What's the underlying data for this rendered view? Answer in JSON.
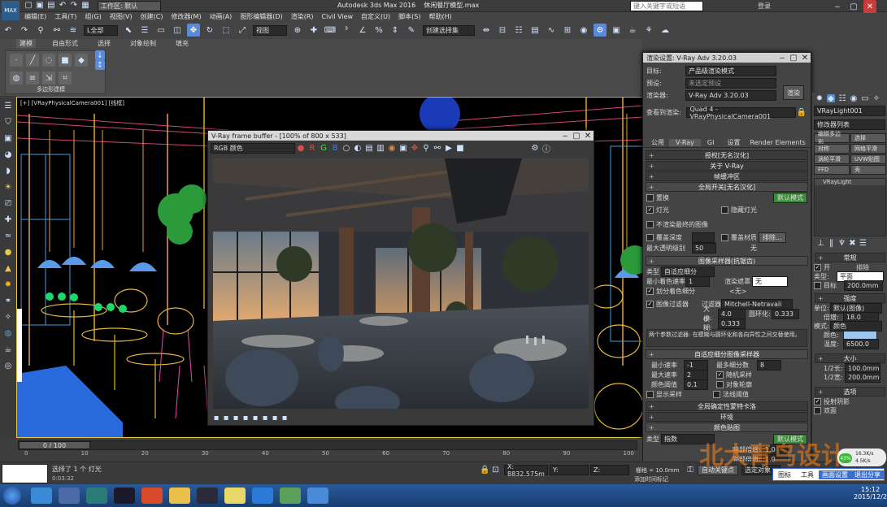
{
  "app": {
    "logo_text": "MAX",
    "workspace_label": "工作区: 默认",
    "title": "Autodesk 3ds Max 2016",
    "file_name": "休闲餐厅模型.max",
    "search_placeholder": "键入关键字或短语",
    "login": "登录"
  },
  "menu": [
    "编辑(E)",
    "工具(T)",
    "组(G)",
    "视图(V)",
    "创建(C)",
    "修改器(M)",
    "动画(A)",
    "图形编辑器(D)",
    "渲染(R)",
    "Civil View",
    "自定义(U)",
    "脚本(S)",
    "帮助(H)"
  ],
  "toolbar": {
    "selection_filter": "L全部",
    "view_dropdown": "视图",
    "named_selection": "创建选择集"
  },
  "ribbon": {
    "tabs": [
      "建模",
      "自由形式",
      "选择",
      "对象绘制",
      "填充"
    ],
    "panel_label": "多边形建模"
  },
  "viewport": {
    "label": "[+] [VRayPhysicalCamera001] [线框]"
  },
  "frame_buffer": {
    "title": "V-Ray frame buffer - [100% of 800 x 533]",
    "channel": "RGB 颜色"
  },
  "render_setup": {
    "title": "渲染设置: V-Ray Adv 3.20.03",
    "target_label": "目标:",
    "target_value": "产品级渲染模式",
    "preset_label": "预设:",
    "preset_value": "未选定预设",
    "renderer_label": "渲染器:",
    "renderer_value": "V-Ray Adv 3.20.03",
    "view_label": "查看到渲染:",
    "view_value": "Quad 4 - VRayPhysicalCamera001",
    "render_button": "渲染",
    "tabs": [
      "公用",
      "V-Ray",
      "GI",
      "设置",
      "Render Elements"
    ],
    "rollouts_top": [
      "授权[无名汉化]",
      "关于 V-Ray",
      "帧缓冲区"
    ],
    "global_switch": "全局开关[无名汉化]",
    "displacement": "置换",
    "default_mode": "默认模式",
    "lights": "灯光",
    "hidden_lights": "隐藏灯光",
    "no_render_final": "不渲染最终的图像",
    "override_depth": "覆盖深度",
    "override_material": "覆盖材质",
    "exclude": "排除...",
    "max_transp": "最大透明级别",
    "max_transp_val": "50",
    "none": "无",
    "image_sampler": "图像采样器(抗锯齿)",
    "type_label": "类型",
    "type_value": "自适应细分",
    "min_rate": "最小着色速率",
    "min_rate_val": "1",
    "render_mask": "渲染遮罩",
    "render_mask_val": "无",
    "divide_shading": "划分着色细分",
    "none_tag": "<无>",
    "filter_label": "图像过滤器",
    "filter_field": "过滤器",
    "filter_value": "Mitchell-Netravali",
    "size_label": "大小:",
    "size_val": "4.0",
    "blur_label": "圆环化:",
    "blur_val": "0.333",
    "ring_label": "模糊:",
    "ring_val": "0.333",
    "filter_desc": "两个参数过滤器: 在模糊与圆环化和各向异性之间交替使用。",
    "adaptive": "自适应细分图像采样器",
    "min_sub": "最小速率",
    "min_sub_val": "-1",
    "max_sub": "最大速率",
    "max_sub_val": "2",
    "color_thresh": "颜色阈值",
    "color_thresh_val": "0.1",
    "max_per": "最多细分数",
    "max_per_val": "8",
    "show_samples": "显示采样",
    "random_sample": "随机采样",
    "object_outline": "对象轮廓",
    "normals": "法线阈值",
    "global_dmc": "全局确定性蒙特卡洛",
    "environment": "环境",
    "color_mapping": "颜色贴图",
    "cm_type_label": "类型",
    "cm_type_value": "指数",
    "dark_mult": "暗部倍增:",
    "dark_mult_val": "1.0",
    "bright_mult": "亮部倍增:",
    "bright_mult_val": "1.0",
    "default_mode2": "默认模式"
  },
  "command_panel": {
    "object_name": "VRayLight001",
    "modifier_list": "修改器列表",
    "btns": [
      "编辑多边形",
      "选择",
      "对称",
      "网格平滑",
      "涡轮平滑",
      "UVW贴图",
      "FFD",
      "壳"
    ],
    "stack_item": "VRayLight",
    "general": "常规",
    "on": "开",
    "exclude": "排除",
    "type_label": "类型:",
    "type_value": "平面",
    "target": "目标",
    "target_val": "200.0mm",
    "intensity": "强度",
    "units_label": "单位:",
    "units_value": "默认(图像)",
    "multiplier": "倍增:",
    "multiplier_val": "18.0",
    "mode_label": "模式:",
    "mode_value": "颜色",
    "color_label": "颜色:",
    "temp_label": "温度:",
    "temp_val": "6500.0",
    "size": "大小",
    "half_len": "1/2长:",
    "half_len_val": "100.0mm",
    "half_wid": "1/2宽:",
    "half_wid_val": "200.0mm",
    "options": "选项",
    "cast_shadows": "投射阴影",
    "double_sided": "双面"
  },
  "timeline": {
    "frame": "0 / 100",
    "ticks": [
      "0",
      "10",
      "20",
      "30",
      "40",
      "50",
      "60",
      "70",
      "80",
      "90",
      "100"
    ]
  },
  "status": {
    "selected": "选择了 1 个 灯光",
    "time_display": "0:03:32",
    "x": "X: 8832.575m",
    "y": "Y:",
    "z": "Z:",
    "grid": "栅格 = 10.0mm",
    "add_time_tag": "添加时间标记",
    "auto_key": "自动关键点",
    "select_obj": "选定对象"
  },
  "watermark": "北大青鸟设计",
  "ime_bar": [
    "图标",
    "工具",
    "画面设置",
    "退出分享"
  ],
  "network": {
    "up": "16.3K/s",
    "down": "4.5K/s",
    "percent": "43%"
  },
  "taskbar": {
    "time": "15:12",
    "date": "2015/12/2"
  },
  "colors": {
    "window_bg": "#444444",
    "viewport_bg": "#000000",
    "panel_bg": "#444444",
    "accent_blue": "#5a8ad8",
    "taskbar": "#1b4e8c",
    "ime_blue": "#3b6fd0"
  }
}
